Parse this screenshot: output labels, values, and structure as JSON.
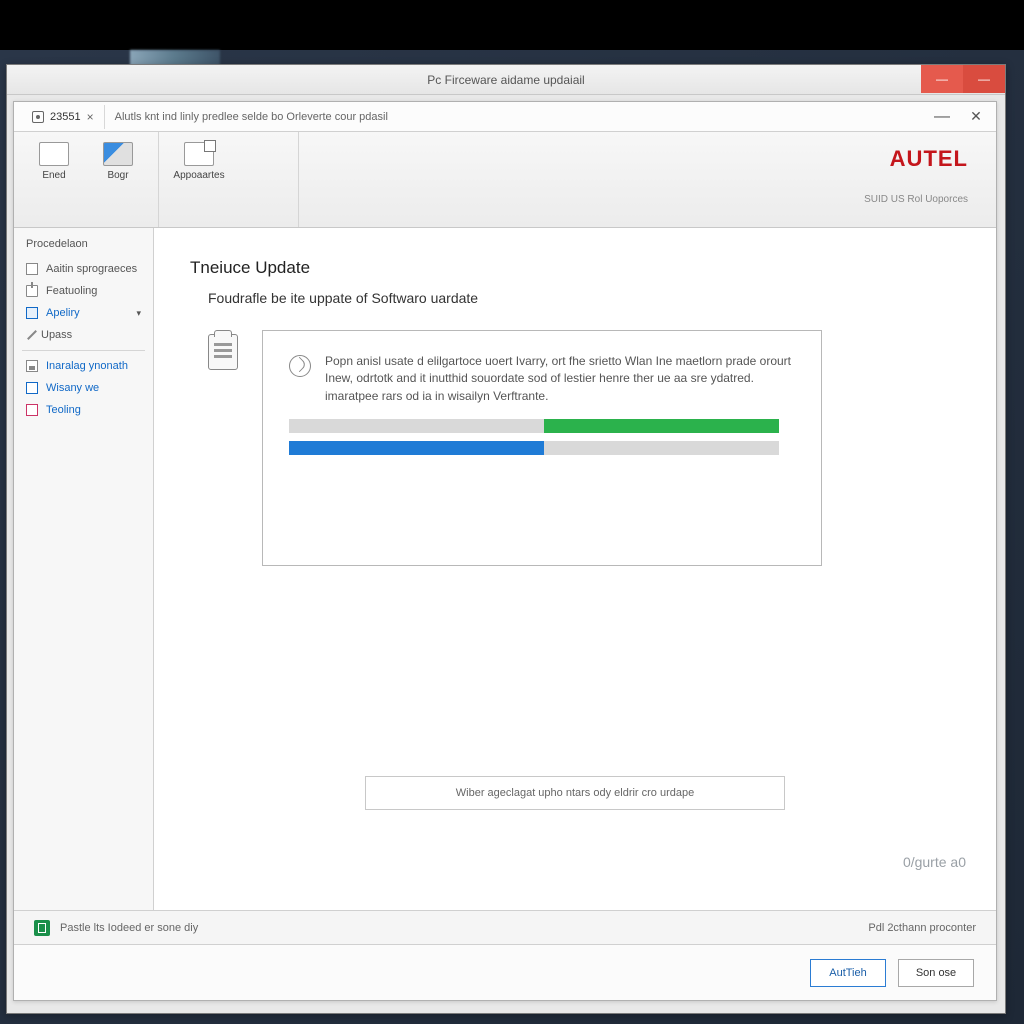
{
  "outer": {
    "title": "Pc Firceware aidame updaiail"
  },
  "inner": {
    "tab_label": "23551",
    "subtitle_bar": "Alutls knt ind linly predlee selde bo Orleverte cour pdasil"
  },
  "toolbar": {
    "ened": "Ened",
    "bogr": "Bogr",
    "appoartes": "Appoaartes"
  },
  "brand": {
    "name": "AUTEL",
    "sub": "SUID US Rol Uoporces"
  },
  "sidebar": {
    "header": "Procedelaon",
    "items": [
      {
        "label": "Aaitin sprograeces"
      },
      {
        "label": "Featuoling"
      },
      {
        "label": "Apeliry"
      },
      {
        "label": "Upass"
      },
      {
        "label": "Inaralag ynonath"
      },
      {
        "label": "Wisany we"
      },
      {
        "label": "Teoling"
      }
    ]
  },
  "main": {
    "heading": "Tneiuce Update",
    "subtitle": "Foudrafle be ite uppate of Softwaro uardate",
    "panel_text": "Popn anisl usate d elilgartoce uoert Ivarry, ort fhe srietto Wlan Ine maetlorn prade orourt Inew, odrtotk and it inutthid souordate sod of lestier henre ther ue aa sre ydatred. imaratpee rars od ia in wisailyn Verftrante.",
    "hint": "Wiber ageclagat upho ntars ody eldrir cro urdape",
    "counter": "0/gurte a0"
  },
  "status": {
    "left": "Pastle lts Iodeed er sone diy",
    "right": "Pdl 2cthann proconter"
  },
  "buttons": {
    "primary": "AutTieh",
    "secondary": "Son ose"
  },
  "progress": {
    "blue_pct": 52,
    "green_start_pct": 52
  }
}
